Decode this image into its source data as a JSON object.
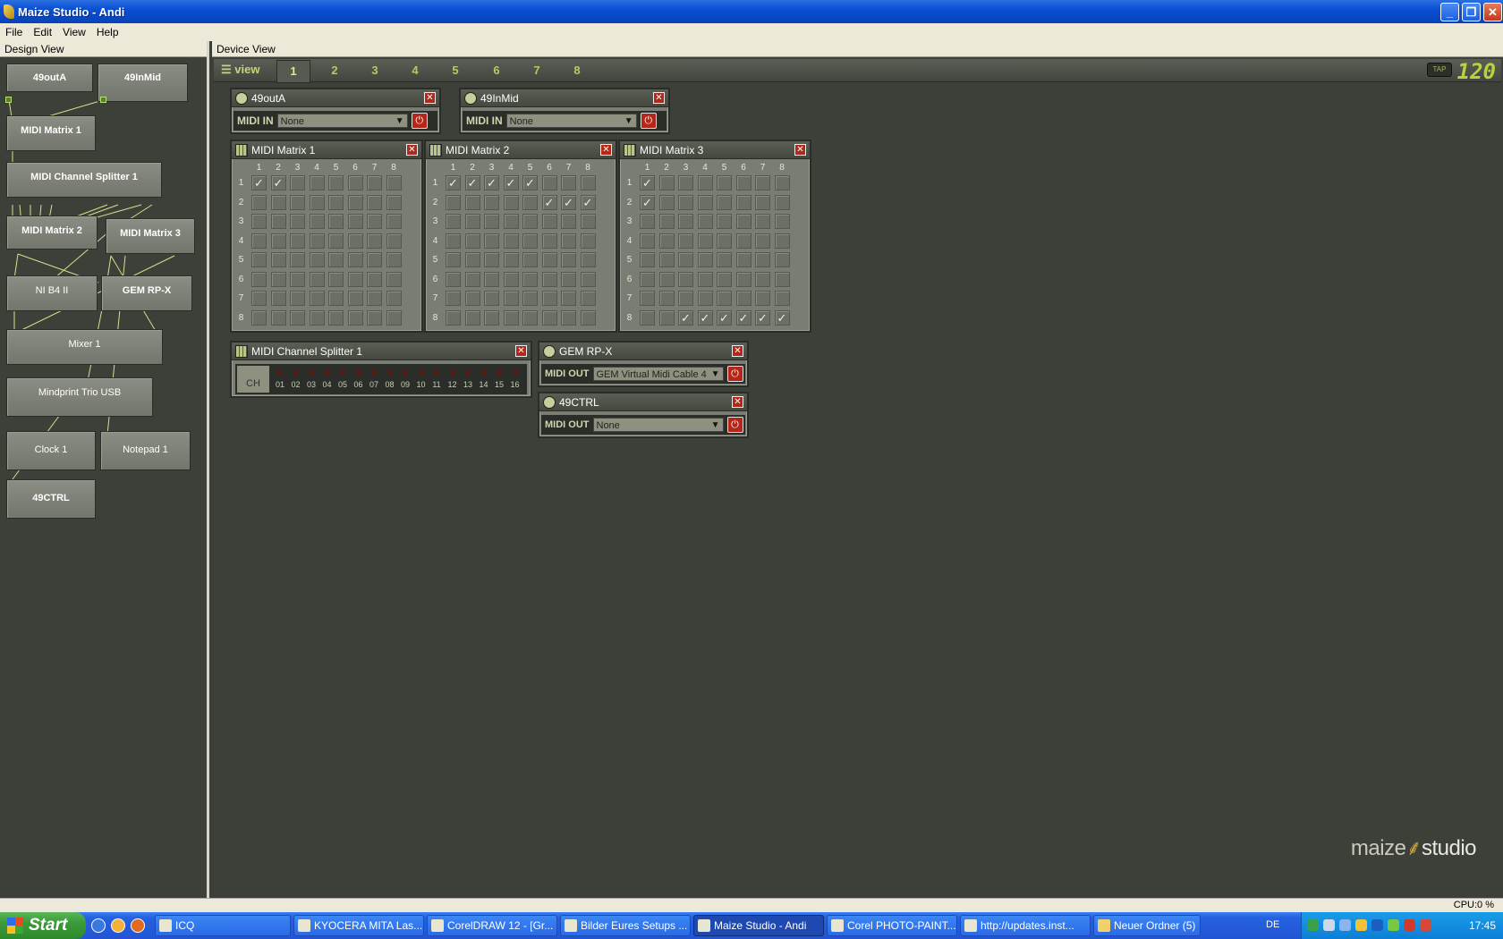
{
  "window": {
    "title": "Maize Studio - Andi"
  },
  "menu": [
    "File",
    "Edit",
    "View",
    "Help"
  ],
  "design_view": {
    "label": "Design View"
  },
  "device_view": {
    "label": "Device View"
  },
  "tabs": {
    "view_label": "view",
    "numbers": [
      "1",
      "2",
      "3",
      "4",
      "5",
      "6",
      "7",
      "8"
    ],
    "active": "1"
  },
  "tempo": {
    "tap_label": "TAP",
    "bpm": "120"
  },
  "design_nodes": [
    {
      "label": "49outA"
    },
    {
      "label": "49InMid"
    },
    {
      "label": "MIDI Matrix 1"
    },
    {
      "label": "MIDI Channel Splitter 1"
    },
    {
      "label": "MIDI Matrix 2"
    },
    {
      "label": "MIDI Matrix 3"
    },
    {
      "label": "NI B4 II"
    },
    {
      "label": "GEM RP-X"
    },
    {
      "label": "Mixer 1"
    },
    {
      "label": "Mindprint Trio USB"
    },
    {
      "label": "Clock 1"
    },
    {
      "label": "Notepad 1"
    },
    {
      "label": "49CTRL"
    }
  ],
  "devices": {
    "in1": {
      "title": "49outA",
      "row_label": "MIDI IN",
      "value": "None"
    },
    "in2": {
      "title": "49InMid",
      "row_label": "MIDI IN",
      "value": "None"
    },
    "mx1": {
      "title": "MIDI Matrix 1"
    },
    "mx2": {
      "title": "MIDI Matrix 2"
    },
    "mx3": {
      "title": "MIDI Matrix 3"
    },
    "split": {
      "title": "MIDI Channel Splitter 1",
      "ch_label": "CH",
      "channels": [
        "01",
        "02",
        "03",
        "04",
        "05",
        "06",
        "07",
        "08",
        "09",
        "10",
        "11",
        "12",
        "13",
        "14",
        "15",
        "16"
      ]
    },
    "gem": {
      "title": "GEM RP-X",
      "row_label": "MIDI OUT",
      "value": "GEM Virtual Midi Cable 4"
    },
    "ctrl": {
      "title": "49CTRL",
      "row_label": "MIDI OUT",
      "value": "None"
    }
  },
  "matrix_labels": [
    "1",
    "2",
    "3",
    "4",
    "5",
    "6",
    "7",
    "8"
  ],
  "matrix_checks": {
    "mx1": [
      [
        1,
        1
      ],
      [
        1,
        2
      ]
    ],
    "mx2": [
      [
        1,
        1
      ],
      [
        1,
        2
      ],
      [
        1,
        3
      ],
      [
        1,
        4
      ],
      [
        1,
        5
      ],
      [
        2,
        6
      ],
      [
        2,
        7
      ],
      [
        2,
        8
      ]
    ],
    "mx3": [
      [
        1,
        1
      ],
      [
        2,
        1
      ],
      [
        8,
        3
      ],
      [
        8,
        4
      ],
      [
        8,
        5
      ],
      [
        8,
        6
      ],
      [
        8,
        7
      ],
      [
        8,
        8
      ]
    ]
  },
  "logo": {
    "prefix": "maize",
    "word": "studio"
  },
  "status": {
    "cpu": "CPU:0 %"
  },
  "taskbar": {
    "start": "Start",
    "tasks": [
      "ICQ",
      "KYOCERA MITA Las...",
      "CorelDRAW 12 - [Gr...",
      "Bilder Eures Setups ...",
      "Maize Studio - Andi",
      "Corel PHOTO-PAINT...",
      "http://updates.inst...",
      "Neuer Ordner (5)"
    ],
    "active_task": "Maize Studio - Andi",
    "lang": "DE",
    "clock": "17:45"
  }
}
